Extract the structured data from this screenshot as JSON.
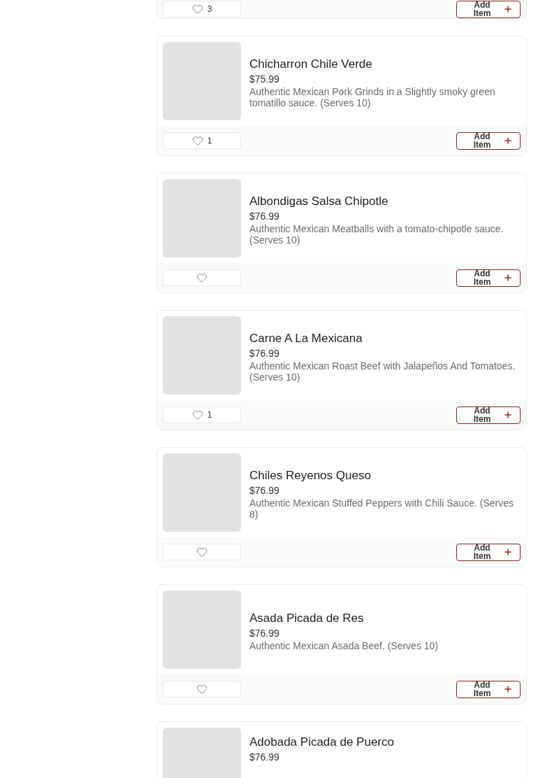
{
  "partial_item": {
    "likes": "3",
    "button": "Add Item"
  },
  "items": [
    {
      "name": "Chicharron Chile Verde",
      "price": "$75.99",
      "description": "Authentic Mexican Pork Grinds in a Slightly smoky green tomatillo sauce. (Serves 10)",
      "likes": "1",
      "button": "Add Item"
    },
    {
      "name": "Albondigas Salsa Chipotle",
      "price": "$76.99",
      "description": "Authentic Mexican Meatballs with a tomato-chipotle sauce. (Serves 10)",
      "button": "Add Item"
    },
    {
      "name": "Carne A La Mexicana",
      "price": "$76.99",
      "description": "Authentic Mexican Roast Beef with Jalapeños And Tomatoes. (Serves 10)",
      "likes": "1",
      "button": "Add Item"
    },
    {
      "name": "Chiles Reyenos Queso",
      "price": "$76.99",
      "description": "Authentic Mexican Stuffed Peppers with Chili Sauce. (Serves 8)",
      "button": "Add Item"
    },
    {
      "name": "Asada Picada de Res",
      "price": "$76.99",
      "description": "Authentic Mexican Asada Beef. (Serves 10)",
      "button": "Add Item"
    },
    {
      "name": "Adobada Picada de Puerco",
      "price": "$76.99"
    }
  ]
}
